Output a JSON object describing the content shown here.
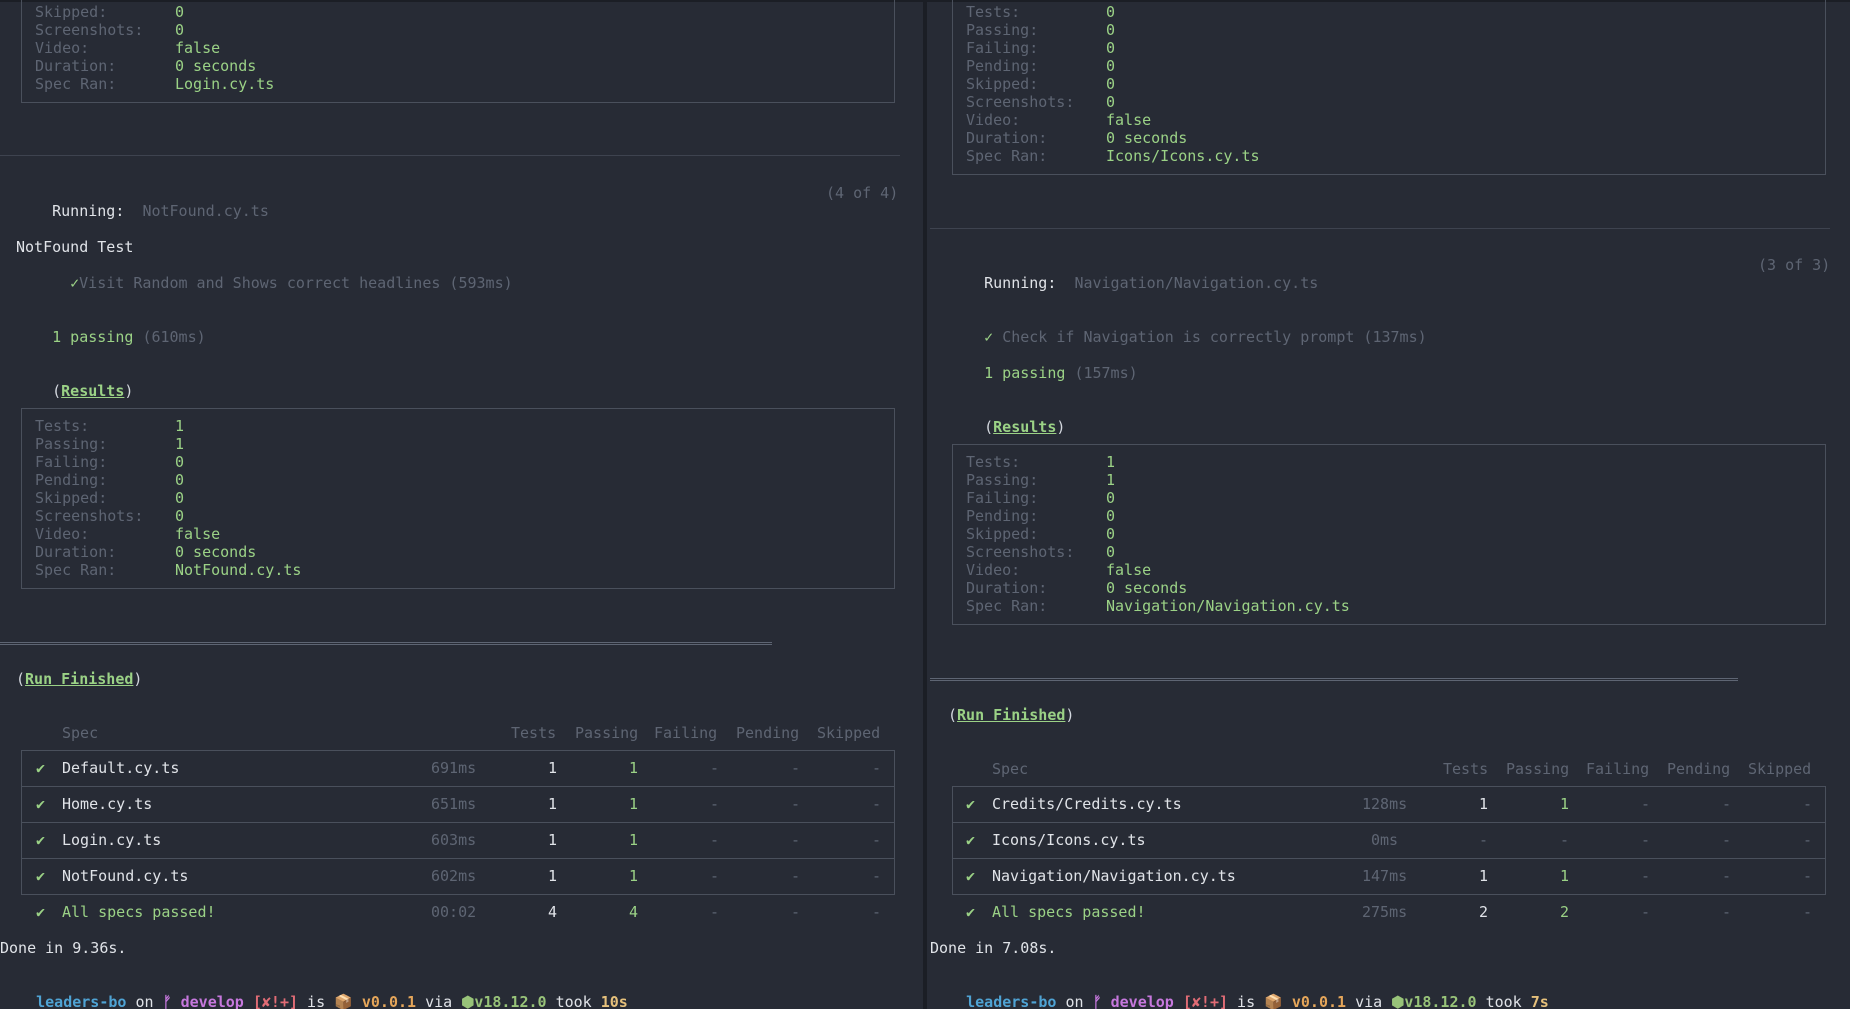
{
  "left": {
    "top_stats": [
      {
        "label": "Skipped:",
        "value": "0"
      },
      {
        "label": "Screenshots:",
        "value": "0"
      },
      {
        "label": "Video:",
        "value": "false"
      },
      {
        "label": "Duration:",
        "value": "0 seconds"
      },
      {
        "label": "Spec Ran:",
        "value": "Login.cy.ts"
      }
    ],
    "running_label": "Running:",
    "running_spec": "NotFound.cy.ts",
    "running_count": "(4 of 4)",
    "suite_name": "NotFound Test",
    "test_check": "✓",
    "test_text": "Visit Random and Shows correct headlines (593ms)",
    "passing_text": "1 passing",
    "passing_time": "(610ms)",
    "results_open": "(",
    "results_label": "Results",
    "results_close": ")",
    "results_stats": [
      {
        "label": "Tests:",
        "value": "1"
      },
      {
        "label": "Passing:",
        "value": "1"
      },
      {
        "label": "Failing:",
        "value": "0"
      },
      {
        "label": "Pending:",
        "value": "0"
      },
      {
        "label": "Skipped:",
        "value": "0"
      },
      {
        "label": "Screenshots:",
        "value": "0"
      },
      {
        "label": "Video:",
        "value": "false"
      },
      {
        "label": "Duration:",
        "value": "0 seconds"
      },
      {
        "label": "Spec Ran:",
        "value": "NotFound.cy.ts"
      }
    ],
    "run_finished": "Run Finished",
    "headers": {
      "spec": "Spec",
      "tests": "Tests",
      "passing": "Passing",
      "failing": "Failing",
      "pending": "Pending",
      "skipped": "Skipped"
    },
    "rows": [
      {
        "check": "✔",
        "spec": "Default.cy.ts",
        "time": "691ms",
        "tests": "1",
        "passing": "1",
        "failing": "-",
        "pending": "-",
        "skipped": "-"
      },
      {
        "check": "✔",
        "spec": "Home.cy.ts",
        "time": "651ms",
        "tests": "1",
        "passing": "1",
        "failing": "-",
        "pending": "-",
        "skipped": "-"
      },
      {
        "check": "✔",
        "spec": "Login.cy.ts",
        "time": "603ms",
        "tests": "1",
        "passing": "1",
        "failing": "-",
        "pending": "-",
        "skipped": "-"
      },
      {
        "check": "✔",
        "spec": "NotFound.cy.ts",
        "time": "602ms",
        "tests": "1",
        "passing": "1",
        "failing": "-",
        "pending": "-",
        "skipped": "-"
      }
    ],
    "summary": {
      "check": "✔",
      "text": "All specs passed!",
      "time": "00:02",
      "tests": "4",
      "passing": "4",
      "failing": "-",
      "pending": "-",
      "skipped": "-"
    },
    "done": "Done in 9.36s.",
    "prompt": {
      "user": "leaders-bo",
      "on": " on ",
      "branch_icon": "ᚠ",
      "branch": " develop ",
      "status": "[✘!+]",
      "is": " is ",
      "pkg_icon": "📦",
      "version": " v0.0.1",
      "via": " via ",
      "node_icon": "⬢",
      "node": "v18.12.0",
      "took": " took ",
      "took_val": "10s",
      "arrow": "➜"
    }
  },
  "right": {
    "top_stats": [
      {
        "label": "Tests:",
        "value": "0"
      },
      {
        "label": "Passing:",
        "value": "0"
      },
      {
        "label": "Failing:",
        "value": "0"
      },
      {
        "label": "Pending:",
        "value": "0"
      },
      {
        "label": "Skipped:",
        "value": "0"
      },
      {
        "label": "Screenshots:",
        "value": "0"
      },
      {
        "label": "Video:",
        "value": "false"
      },
      {
        "label": "Duration:",
        "value": "0 seconds"
      },
      {
        "label": "Spec Ran:",
        "value": "Icons/Icons.cy.ts"
      }
    ],
    "running_label": "Running:",
    "running_spec": "Navigation/Navigation.cy.ts",
    "running_count": "(3 of 3)",
    "test_check": "✓",
    "test_text": "Check if Navigation is correctly prompt (137ms)",
    "passing_text": "1 passing",
    "passing_time": "(157ms)",
    "results_open": "(",
    "results_label": "Results",
    "results_close": ")",
    "results_stats": [
      {
        "label": "Tests:",
        "value": "1"
      },
      {
        "label": "Passing:",
        "value": "1"
      },
      {
        "label": "Failing:",
        "value": "0"
      },
      {
        "label": "Pending:",
        "value": "0"
      },
      {
        "label": "Skipped:",
        "value": "0"
      },
      {
        "label": "Screenshots:",
        "value": "0"
      },
      {
        "label": "Video:",
        "value": "false"
      },
      {
        "label": "Duration:",
        "value": "0 seconds"
      },
      {
        "label": "Spec Ran:",
        "value": "Navigation/Navigation.cy.ts"
      }
    ],
    "run_finished": "Run Finished",
    "headers": {
      "spec": "Spec",
      "tests": "Tests",
      "passing": "Passing",
      "failing": "Failing",
      "pending": "Pending",
      "skipped": "Skipped"
    },
    "rows": [
      {
        "check": "✔",
        "spec": "Credits/Credits.cy.ts",
        "time": "128ms",
        "tests": "1",
        "passing": "1",
        "failing": "-",
        "pending": "-",
        "skipped": "-"
      },
      {
        "check": "✔",
        "spec": "Icons/Icons.cy.ts",
        "time": "0ms",
        "tests": "-",
        "passing": "-",
        "failing": "-",
        "pending": "-",
        "skipped": "-"
      },
      {
        "check": "✔",
        "spec": "Navigation/Navigation.cy.ts",
        "time": "147ms",
        "tests": "1",
        "passing": "1",
        "failing": "-",
        "pending": "-",
        "skipped": "-"
      }
    ],
    "summary": {
      "check": "✔",
      "text": "All specs passed!",
      "time": "275ms",
      "tests": "2",
      "passing": "2",
      "failing": "-",
      "pending": "-",
      "skipped": "-"
    },
    "done": "Done in 7.08s.",
    "prompt": {
      "user": "leaders-bo",
      "on": " on ",
      "branch_icon": "ᚠ",
      "branch": " develop ",
      "status": "[✘!+]",
      "is": " is ",
      "pkg_icon": "📦",
      "version": " v0.0.1",
      "via": " via ",
      "node_icon": "⬢",
      "node": "v18.12.0",
      "took": " took ",
      "took_val": "7s",
      "arrow": "➜"
    }
  }
}
